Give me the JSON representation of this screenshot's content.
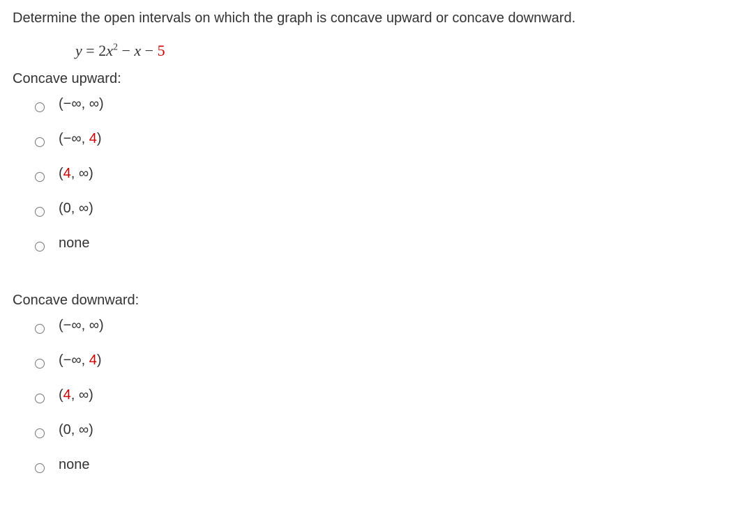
{
  "question": "Determine the open intervals on which the graph is concave upward or concave downward.",
  "equation": {
    "lhs": "y",
    "eq": " = ",
    "coef1": "2",
    "var1": "x",
    "exp": "2",
    "minus1": " − ",
    "var2": "x",
    "minus2": " − ",
    "constant": "5"
  },
  "upward": {
    "label": "Concave upward:",
    "options": [
      {
        "text_pre": "(−∞, ∞)",
        "red": "",
        "text_post": ""
      },
      {
        "text_pre": "(−∞, ",
        "red": "4",
        "text_post": ")"
      },
      {
        "text_pre": "(",
        "red": "4",
        "text_post": ", ∞)"
      },
      {
        "text_pre": "(0, ∞)",
        "red": "",
        "text_post": ""
      },
      {
        "text_pre": "none",
        "red": "",
        "text_post": ""
      }
    ]
  },
  "downward": {
    "label": "Concave downward:",
    "options": [
      {
        "text_pre": "(−∞, ∞)",
        "red": "",
        "text_post": ""
      },
      {
        "text_pre": "(−∞, ",
        "red": "4",
        "text_post": ")"
      },
      {
        "text_pre": "(",
        "red": "4",
        "text_post": ", ∞)"
      },
      {
        "text_pre": "(0, ∞)",
        "red": "",
        "text_post": ""
      },
      {
        "text_pre": "none",
        "red": "",
        "text_post": ""
      }
    ]
  }
}
